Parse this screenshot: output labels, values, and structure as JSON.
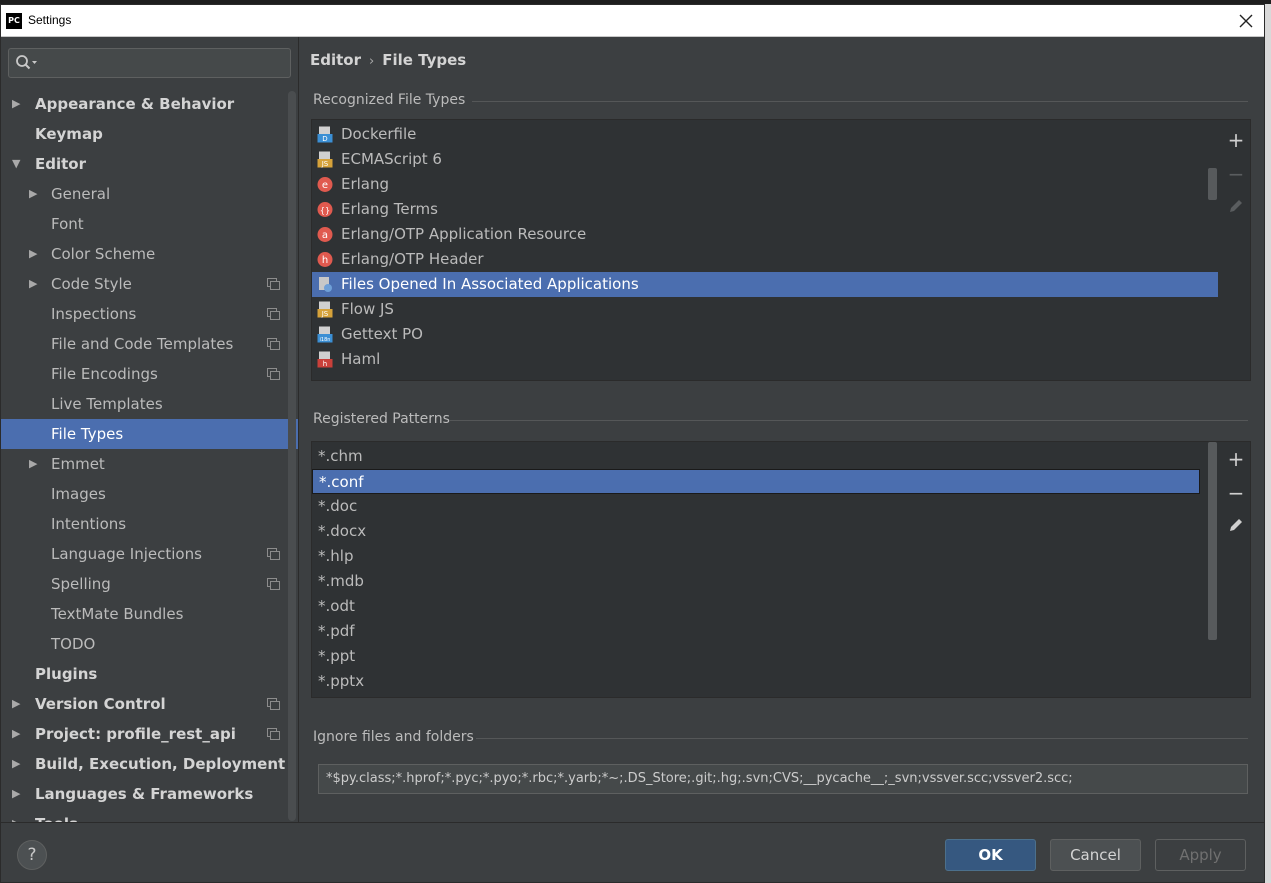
{
  "window": {
    "title": "Settings",
    "app_icon_label": "PC"
  },
  "search": {
    "placeholder": ""
  },
  "sidebar": {
    "items": [
      {
        "label": "Appearance & Behavior",
        "level": 0,
        "arrow": "▶",
        "selected": false,
        "project_icon": false
      },
      {
        "label": "Keymap",
        "level": 0,
        "arrow": "",
        "selected": false,
        "project_icon": false
      },
      {
        "label": "Editor",
        "level": 0,
        "arrow": "▼",
        "selected": false,
        "project_icon": false
      },
      {
        "label": "General",
        "level": 1,
        "arrow": "▶",
        "selected": false,
        "project_icon": false
      },
      {
        "label": "Font",
        "level": 1,
        "arrow": "",
        "selected": false,
        "project_icon": false
      },
      {
        "label": "Color Scheme",
        "level": 1,
        "arrow": "▶",
        "selected": false,
        "project_icon": false
      },
      {
        "label": "Code Style",
        "level": 1,
        "arrow": "▶",
        "selected": false,
        "project_icon": true
      },
      {
        "label": "Inspections",
        "level": 1,
        "arrow": "",
        "selected": false,
        "project_icon": true
      },
      {
        "label": "File and Code Templates",
        "level": 1,
        "arrow": "",
        "selected": false,
        "project_icon": true
      },
      {
        "label": "File Encodings",
        "level": 1,
        "arrow": "",
        "selected": false,
        "project_icon": true
      },
      {
        "label": "Live Templates",
        "level": 1,
        "arrow": "",
        "selected": false,
        "project_icon": false
      },
      {
        "label": "File Types",
        "level": 1,
        "arrow": "",
        "selected": true,
        "project_icon": false
      },
      {
        "label": "Emmet",
        "level": 1,
        "arrow": "▶",
        "selected": false,
        "project_icon": false
      },
      {
        "label": "Images",
        "level": 1,
        "arrow": "",
        "selected": false,
        "project_icon": false
      },
      {
        "label": "Intentions",
        "level": 1,
        "arrow": "",
        "selected": false,
        "project_icon": false
      },
      {
        "label": "Language Injections",
        "level": 1,
        "arrow": "",
        "selected": false,
        "project_icon": true
      },
      {
        "label": "Spelling",
        "level": 1,
        "arrow": "",
        "selected": false,
        "project_icon": true
      },
      {
        "label": "TextMate Bundles",
        "level": 1,
        "arrow": "",
        "selected": false,
        "project_icon": false
      },
      {
        "label": "TODO",
        "level": 1,
        "arrow": "",
        "selected": false,
        "project_icon": false
      },
      {
        "label": "Plugins",
        "level": 0,
        "arrow": "",
        "selected": false,
        "project_icon": false
      },
      {
        "label": "Version Control",
        "level": 0,
        "arrow": "▶",
        "selected": false,
        "project_icon": true
      },
      {
        "label": "Project: profile_rest_api",
        "level": 0,
        "arrow": "▶",
        "selected": false,
        "project_icon": true
      },
      {
        "label": "Build, Execution, Deployment",
        "level": 0,
        "arrow": "▶",
        "selected": false,
        "project_icon": false
      },
      {
        "label": "Languages & Frameworks",
        "level": 0,
        "arrow": "▶",
        "selected": false,
        "project_icon": false
      },
      {
        "label": "Tools",
        "level": 0,
        "arrow": "▶",
        "selected": false,
        "project_icon": false
      }
    ]
  },
  "breadcrumb": {
    "parent": "Editor",
    "separator": "›",
    "current": "File Types"
  },
  "recognized": {
    "title": "Recognized File Types",
    "items": [
      {
        "label": "Dockerfile",
        "icon": "dockerfile-icon",
        "color": "#3b8fd4",
        "glyph": "D",
        "selected": false
      },
      {
        "label": "ECMAScript 6",
        "icon": "ecmascript-icon",
        "color": "#d6a23a",
        "glyph": "JS",
        "selected": false
      },
      {
        "label": "Erlang",
        "icon": "erlang-icon",
        "color": "#e05a4f",
        "glyph": "e",
        "selected": false
      },
      {
        "label": "Erlang Terms",
        "icon": "erlang-terms-icon",
        "color": "#e05a4f",
        "glyph": "{}",
        "selected": false
      },
      {
        "label": "Erlang/OTP Application Resource",
        "icon": "erlang-app-icon",
        "color": "#e05a4f",
        "glyph": "a",
        "selected": false
      },
      {
        "label": "Erlang/OTP Header",
        "icon": "erlang-header-icon",
        "color": "#e05a4f",
        "glyph": "h",
        "selected": false
      },
      {
        "label": "Files Opened In Associated Applications",
        "icon": "associated-apps-icon",
        "color": "#6fa0d8",
        "glyph": "",
        "selected": true
      },
      {
        "label": "Flow JS",
        "icon": "flow-js-icon",
        "color": "#d6a23a",
        "glyph": "JS",
        "selected": false
      },
      {
        "label": "Gettext PO",
        "icon": "gettext-icon",
        "color": "#3b8fd4",
        "glyph": "i18n",
        "selected": false
      },
      {
        "label": "Haml",
        "icon": "haml-icon",
        "color": "#c9403a",
        "glyph": "h",
        "selected": false
      }
    ]
  },
  "patterns": {
    "title": "Registered Patterns",
    "items": [
      {
        "label": "*.chm",
        "selected": false
      },
      {
        "label": "*.conf",
        "selected": true
      },
      {
        "label": "*.doc",
        "selected": false
      },
      {
        "label": "*.docx",
        "selected": false
      },
      {
        "label": "*.hlp",
        "selected": false
      },
      {
        "label": "*.mdb",
        "selected": false
      },
      {
        "label": "*.odt",
        "selected": false
      },
      {
        "label": "*.pdf",
        "selected": false
      },
      {
        "label": "*.ppt",
        "selected": false
      },
      {
        "label": "*.pptx",
        "selected": false
      }
    ]
  },
  "ignore": {
    "title": "Ignore files and folders",
    "value": "*$py.class;*.hprof;*.pyc;*.pyo;*.rbc;*.yarb;*~;.DS_Store;.git;.hg;.svn;CVS;__pycache__;_svn;vssver.scc;vssver2.scc;"
  },
  "tools": {
    "add": "+",
    "remove": "−",
    "edit": "✎"
  },
  "footer": {
    "help": "?",
    "ok": "OK",
    "cancel": "Cancel",
    "apply": "Apply"
  },
  "colors": {
    "selection": "#4b6eaf",
    "background": "#3c3f41",
    "list_bg": "#2f3234",
    "ok_button": "#365880"
  }
}
